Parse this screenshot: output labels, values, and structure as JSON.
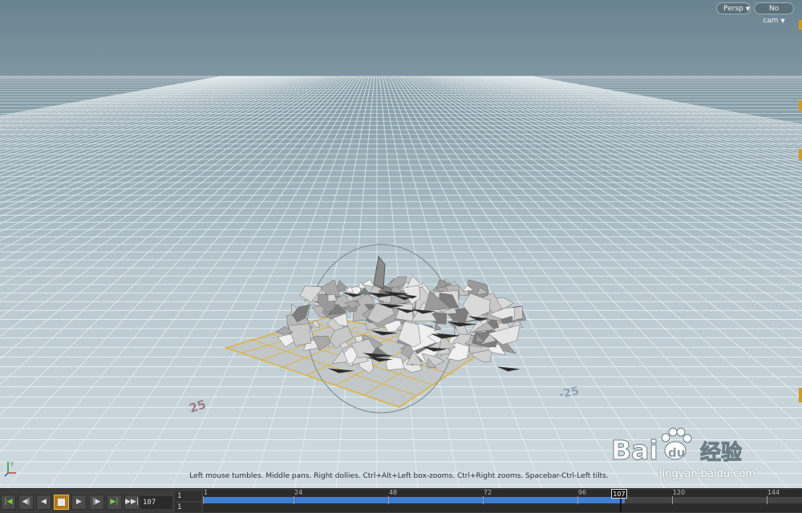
{
  "viewport": {
    "persp_label": "Persp",
    "cam_label": "No cam",
    "hint": "Left mouse tumbles. Middle pans. Right dollies. Ctrl+Alt+Left box-zooms. Ctrl+Right zooms. Spacebar-Ctrl-Left tilts.",
    "grid_labels": [
      "25",
      "-25"
    ],
    "sky_color": "#6e8793",
    "ground_color": "#c6d3d8",
    "accent_color": "#d49a1c"
  },
  "watermark": {
    "brand": "Bai",
    "brand2": "du",
    "cn": "经验",
    "url": "jingyan.baidu.com"
  },
  "playbar": {
    "buttons": [
      {
        "name": "jump-start-button",
        "glyph": "|◀",
        "green": true
      },
      {
        "name": "step-back-key-button",
        "glyph": "◀|",
        "green": false
      },
      {
        "name": "play-reverse-button",
        "glyph": "◀",
        "green": false
      },
      {
        "name": "stop-button",
        "glyph": "",
        "green": false,
        "active": true
      },
      {
        "name": "play-forward-button",
        "glyph": "▶",
        "green": false
      },
      {
        "name": "step-forward-key-button",
        "glyph": "|▶",
        "green": false
      },
      {
        "name": "step-forward-button",
        "glyph": "▶|",
        "green": true
      },
      {
        "name": "jump-end-button",
        "glyph": "▶▶|",
        "green": false
      }
    ],
    "current_frame": "107",
    "range_start": "1",
    "range_start_2": "1",
    "timeline_ticks": [
      "1",
      "24",
      "48",
      "72",
      "96",
      "120",
      "144"
    ],
    "timeline_start": 1,
    "timeline_end": 153,
    "current": 107,
    "cached_until": 108,
    "fill_color": "#3f7ed3"
  }
}
